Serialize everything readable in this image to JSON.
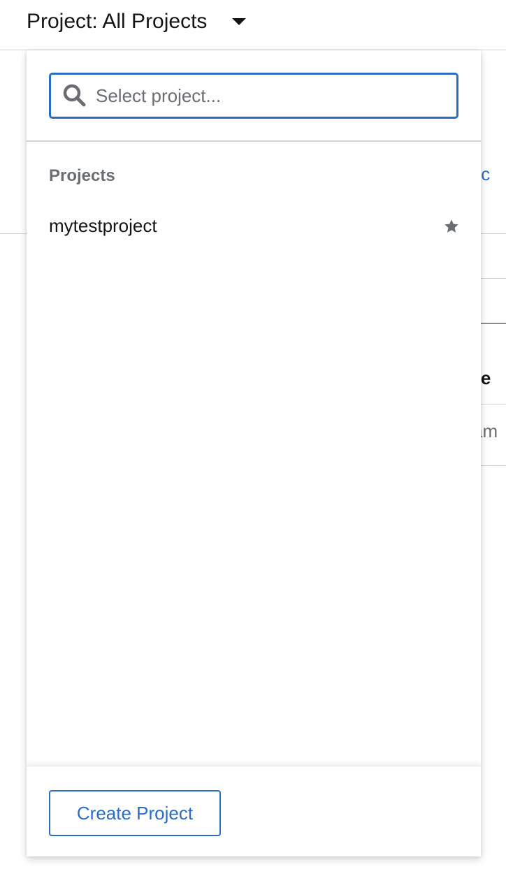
{
  "header": {
    "project_toggle_label": "Project: All Projects",
    "toggle_icon": "caret-down-icon"
  },
  "menu": {
    "search": {
      "placeholder": "Select project...",
      "value": "",
      "icon": "search-icon"
    },
    "group_title": "Projects",
    "projects": [
      {
        "name": "mytestproject",
        "favorite_icon": "star-icon"
      }
    ],
    "create_button_label": "Create Project"
  },
  "background": {
    "link_fragment": "jec",
    "column_header_fragment": "ne",
    "cell_fragment": "am"
  },
  "colors": {
    "accent": "#2b6cc4",
    "text": "#151515",
    "muted": "#6a6e73",
    "border": "#d2d2d2"
  }
}
